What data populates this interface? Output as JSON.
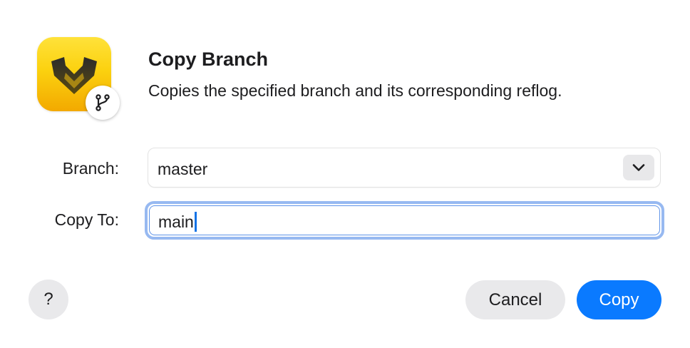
{
  "dialog": {
    "title": "Copy Branch",
    "description": "Copies the specified branch and its corresponding reflog."
  },
  "app_icon": {
    "name": "fork-app-icon",
    "badge_icon": "git-branch-icon",
    "accent_color": "#fbd10f"
  },
  "form": {
    "branch_label": "Branch:",
    "branch_value": "master",
    "copy_to_label": "Copy To:",
    "copy_to_value": "main"
  },
  "buttons": {
    "help_label": "?",
    "cancel_label": "Cancel",
    "copy_label": "Copy"
  },
  "colors": {
    "primary": "#0a7aff",
    "focus_ring": "#97b9f1"
  }
}
